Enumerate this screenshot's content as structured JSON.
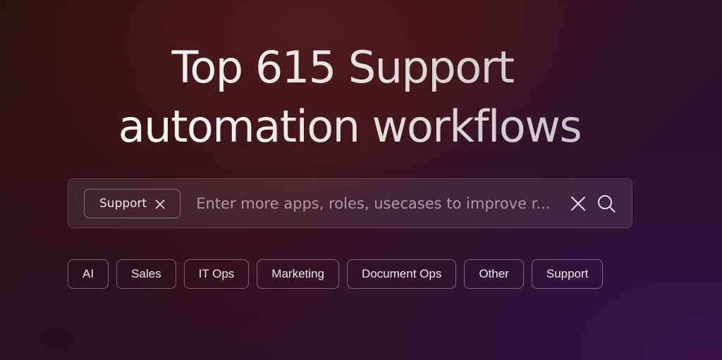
{
  "hero": {
    "line1": "Top 615 Support",
    "line2": "automation workflows"
  },
  "search": {
    "chip_label": "Support",
    "placeholder": "Enter more apps, roles, usecases to improve r...",
    "chip_remove_icon": "close-icon",
    "clear_icon": "close-icon",
    "search_icon": "search-icon"
  },
  "tags": [
    {
      "label": "AI"
    },
    {
      "label": "Sales"
    },
    {
      "label": "IT Ops"
    },
    {
      "label": "Marketing"
    },
    {
      "label": "Document Ops"
    },
    {
      "label": "Other"
    },
    {
      "label": "Support"
    }
  ],
  "colors": {
    "text": "#efe9ec",
    "background_start": "#2b1012",
    "background_end": "#2a0f2c"
  }
}
